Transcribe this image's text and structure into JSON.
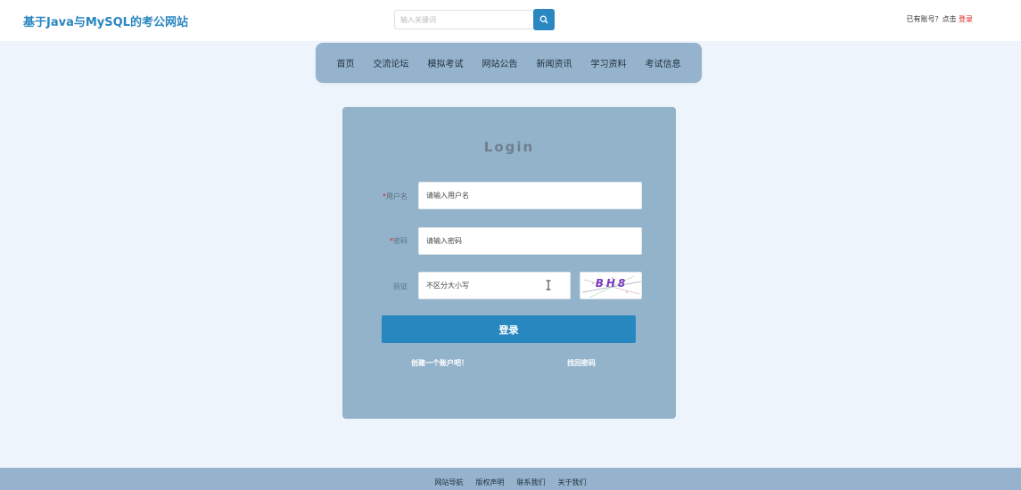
{
  "header": {
    "site_title": "基于Java与MySQL的考公网站",
    "search_placeholder": "输入关键词",
    "account_prompt": "已有账号？点击",
    "login_link": "登录"
  },
  "nav": {
    "items": [
      {
        "label": "首页"
      },
      {
        "label": "交流论坛"
      },
      {
        "label": "模拟考试"
      },
      {
        "label": "网站公告"
      },
      {
        "label": "新闻资讯"
      },
      {
        "label": "学习资料"
      },
      {
        "label": "考试信息"
      }
    ]
  },
  "login_form": {
    "title": "Login",
    "username_label": "用户名",
    "username_placeholder": "请输入用户名",
    "password_label": "密码",
    "password_placeholder": "请输入密码",
    "captcha_label": "验证",
    "captcha_placeholder": "不区分大小写",
    "captcha_text": "BH8",
    "required_mark": "*",
    "submit_label": "登录",
    "register_link": "创建一个账户吧！",
    "forgot_link": "找回密码"
  },
  "footer": {
    "items": [
      {
        "label": "网站导航"
      },
      {
        "label": "版权声明"
      },
      {
        "label": "联系我们"
      },
      {
        "label": "关于我们"
      }
    ]
  },
  "colors": {
    "accent": "#2987c0",
    "nav_bg": "#95b3cc",
    "card_bg": "#93b3cb",
    "page_bg": "#eef4fb",
    "required": "#e02020"
  },
  "icons": {
    "search": "search-icon",
    "cursor": "text-cursor-icon"
  }
}
